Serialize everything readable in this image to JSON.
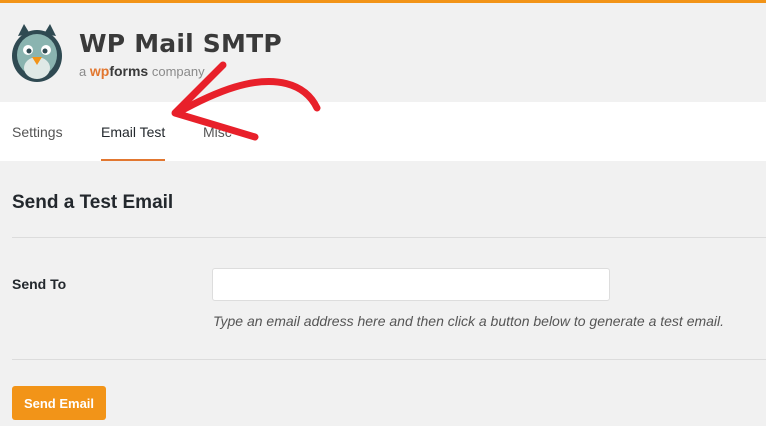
{
  "branding": {
    "title": "WP Mail SMTP",
    "sub_prefix": "a",
    "sub_wp": "wp",
    "sub_forms": "forms",
    "sub_suffix": "company",
    "logo_icon": "pigeon-mascot-icon"
  },
  "tabs": [
    {
      "label": "Settings",
      "active": false
    },
    {
      "label": "Email Test",
      "active": true
    },
    {
      "label": "Misc",
      "active": false
    }
  ],
  "main": {
    "section_title": "Send a Test Email",
    "send_to_label": "Send To",
    "send_to_value": "",
    "send_to_placeholder": "",
    "description": "Type an email address here and then click a button below to generate a test email.",
    "send_button_label": "Send Email"
  },
  "annotation": {
    "icon": "red-arrow-icon",
    "color": "#e8202a"
  },
  "colors": {
    "accent": "#f29418",
    "tab_underline": "#e27730",
    "background": "#f1f1f1"
  }
}
